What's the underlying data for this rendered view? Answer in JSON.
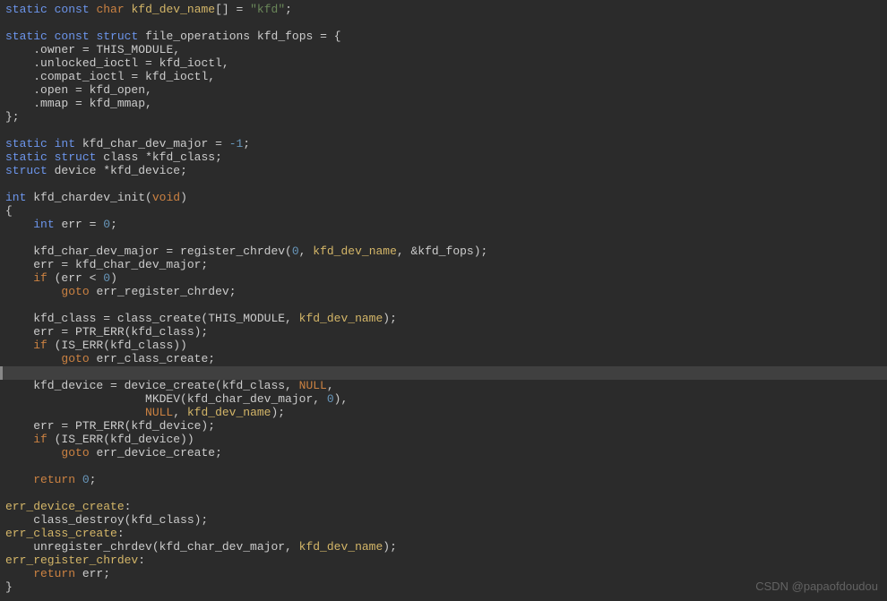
{
  "watermark": "CSDN @papaofdoudou",
  "keywords": {
    "static": "static",
    "const": "const",
    "char": "char",
    "struct": "struct",
    "int": "int",
    "void": "void",
    "if": "if",
    "goto": "goto",
    "return": "return",
    "NULL": "NULL"
  },
  "identifiers": {
    "kfd_dev_name": "kfd_dev_name",
    "file_operations": "file_operations",
    "kfd_fops": "kfd_fops",
    "owner": ".owner = THIS_MODULE,",
    "unlocked_ioctl": ".unlocked_ioctl = kfd_ioctl,",
    "compat_ioctl": ".compat_ioctl = kfd_ioctl,",
    "open": ".open = kfd_open,",
    "mmap": ".mmap = kfd_mmap,",
    "kfd_char_dev_major": "kfd_char_dev_major",
    "class": "class",
    "kfd_class": "*kfd_class;",
    "device": "device",
    "kfd_device": "*kfd_device;",
    "kfd_chardev_init": "kfd_chardev_init",
    "err": "err",
    "register_chrdev": "register_chrdev",
    "err_register_chrdev": "err_register_chrdev",
    "class_create": "class_create",
    "THIS_MODULE": "THIS_MODULE",
    "PTR_ERR": "PTR_ERR",
    "IS_ERR": "IS_ERR",
    "err_class_create": "err_class_create",
    "device_create": "device_create",
    "MKDEV": "MKDEV",
    "err_device_create": "err_device_create",
    "class_destroy": "class_destroy",
    "unregister_chrdev": "unregister_chrdev"
  },
  "strings": {
    "kfd": "\"kfd\""
  },
  "numbers": {
    "neg1": "-1",
    "zero": "0"
  },
  "labels": {
    "err_device_create": "err_device_create",
    "err_class_create": "err_class_create",
    "err_register_chrdev": "err_register_chrdev"
  },
  "fragments": {
    "brackets_eq": "[] = ",
    "semicolon": ";",
    "eq_brace": " = {",
    "close_brace_semi": "};",
    "open_paren": "(",
    "close_paren": ")",
    "open_brace": "{",
    "close_brace": "}",
    "eq": " = ",
    "comma_sp": ", ",
    "amp": "&",
    "lt": " < ",
    "colon": ":",
    "sp": " ",
    "indent1": "    ",
    "indent2": "        ",
    "kfd_char_dev_major_assign": "    kfd_char_dev_major = register_chrdev(",
    "kfd_fops_tail": ", &kfd_fops);",
    "err_assign_major": "    err = kfd_char_dev_major;",
    "if_err_lt_0": " (err < ",
    "goto_sp": " ",
    "kfd_class_assign": "    kfd_class = class_create(THIS_MODULE, ",
    "close_paren_semi": ");",
    "err_ptr_class": "    err = PTR_ERR(kfd_class);",
    "if_iserr_class": " (IS_ERR(kfd_class))",
    "kfd_device_assign": "    kfd_device = device_create(kfd_class, ",
    "comma": ",",
    "mkdev_line": "                    MKDEV(kfd_char_dev_major, ",
    "close_mkdev": "),",
    "null_line": "                    ",
    "err_ptr_device": "    err = PTR_ERR(kfd_device);",
    "if_iserr_device": " (IS_ERR(kfd_device))",
    "return_0": " ",
    "class_destroy_line": "    class_destroy(kfd_class);",
    "unregister_line": "    unregister_chrdev(kfd_char_dev_major, ",
    "return_err": " err;"
  }
}
